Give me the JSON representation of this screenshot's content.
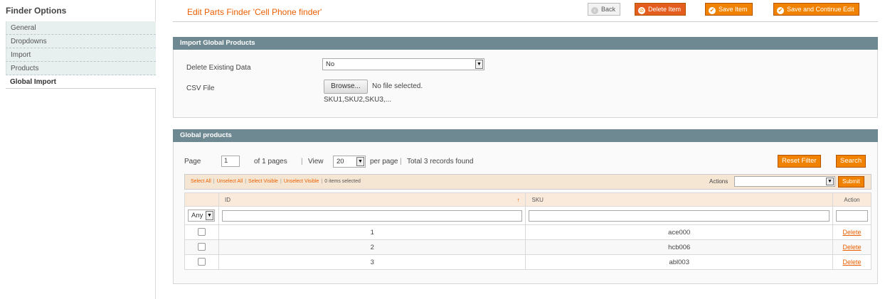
{
  "sidebar": {
    "title": "Finder Options",
    "tabs": [
      {
        "label": "General"
      },
      {
        "label": "Dropdowns"
      },
      {
        "label": "Import"
      },
      {
        "label": "Products"
      },
      {
        "label": "Global Import",
        "active": true
      }
    ]
  },
  "header": {
    "title": "Edit Parts Finder 'Cell Phone finder'",
    "buttons": {
      "back": "Back",
      "delete": "Delete Item",
      "save": "Save Item",
      "save_continue": "Save and Continue Edit"
    }
  },
  "import_section": {
    "title": "Import Global Products",
    "delete_existing_label": "Delete Existing Data",
    "delete_existing_value": "No",
    "csv_file_label": "CSV File",
    "browse_label": "Browse...",
    "file_status": "No file selected.",
    "note": "SKU1,SKU2,SKU3,..."
  },
  "grid_section": {
    "title": "Global products",
    "pager": {
      "page_label": "Page",
      "page_value": "1",
      "of_pages": "of 1 pages",
      "view_label": "View",
      "per_page_value": "20",
      "per_page_label": "per page",
      "total": "Total 3 records found"
    },
    "reset_filter": "Reset Filter",
    "search": "Search",
    "massaction": {
      "select_all": "Select All",
      "unselect_all": "Unselect All",
      "select_visible": "Select Visible",
      "unselect_visible": "Unselect Visible",
      "selected_count": "0 items selected",
      "actions_label": "Actions",
      "submit": "Submit"
    },
    "columns": {
      "id": "ID",
      "sku": "SKU",
      "action": "Action"
    },
    "filter_any": "Any",
    "rows": [
      {
        "id": "1",
        "sku": "ace000",
        "action": "Delete"
      },
      {
        "id": "2",
        "sku": "hcb006",
        "action": "Delete"
      },
      {
        "id": "3",
        "sku": "abl003",
        "action": "Delete"
      }
    ]
  }
}
